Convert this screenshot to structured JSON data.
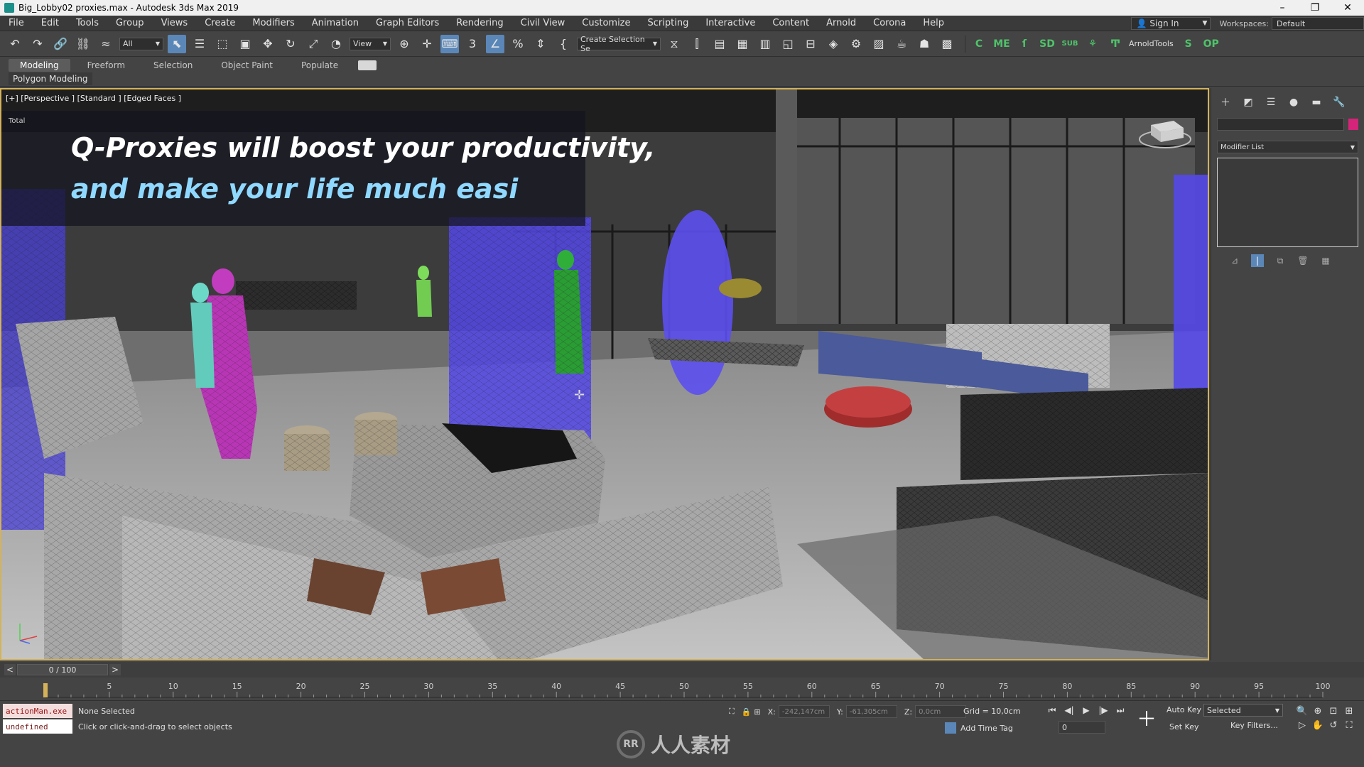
{
  "window": {
    "title": "Big_Lobby02 proxies.max - Autodesk 3ds Max 2019",
    "controls": [
      "–",
      "❐",
      "✕"
    ]
  },
  "menu": {
    "items": [
      "File",
      "Edit",
      "Tools",
      "Group",
      "Views",
      "Create",
      "Modifiers",
      "Animation",
      "Graph Editors",
      "Rendering",
      "Civil View",
      "Customize",
      "Scripting",
      "Interactive",
      "Content",
      "Arnold",
      "Corona",
      "Help"
    ],
    "sign_in": "Sign In",
    "workspaces_label": "Workspaces:",
    "workspaces_value": "Default"
  },
  "toolbar": {
    "filter_value": "All",
    "ref_coord_value": "View",
    "selection_set_value": "Create Selection Se",
    "arnold_tools": "ArnoldTools"
  },
  "ribbon": {
    "tabs": [
      "Modeling",
      "Freeform",
      "Selection",
      "Object Paint",
      "Populate"
    ],
    "active_tab": "Modeling",
    "sub_label": "Polygon Modeling"
  },
  "viewport": {
    "label": "[+] [Perspective ] [Standard ] [Edged Faces ]",
    "stats_label": "Total",
    "caption_line1": "Q-Proxies will boost your productivity,",
    "caption_line2": "and make your life much easi"
  },
  "command_panel": {
    "modifier_list": "Modifier List",
    "accent_color": "#d6247a"
  },
  "time_slider": {
    "frame_display": "0 / 100",
    "ticks": [
      5,
      10,
      15,
      20,
      25,
      30,
      35,
      40,
      45,
      50,
      55,
      60,
      65,
      70,
      75,
      80,
      85,
      90,
      95,
      100
    ]
  },
  "status": {
    "maxscript_line1": "actionMan.exe",
    "maxscript_line2": "undefined",
    "selection_text": "None Selected",
    "prompt_text": "Click or click-and-drag to select objects",
    "x_label": "X:",
    "x_value": "-242,147cm",
    "y_label": "Y:",
    "y_value": "-61,305cm",
    "z_label": "Z:",
    "z_value": "0,0cm",
    "grid_text": "Grid = 10,0cm",
    "add_time_tag": "Add Time Tag",
    "current_frame": "0",
    "auto_key": "Auto Key",
    "set_key": "Set Key",
    "key_mode": "Selected",
    "key_filters": "Key Filters..."
  },
  "watermark": {
    "text": "人人素材"
  }
}
